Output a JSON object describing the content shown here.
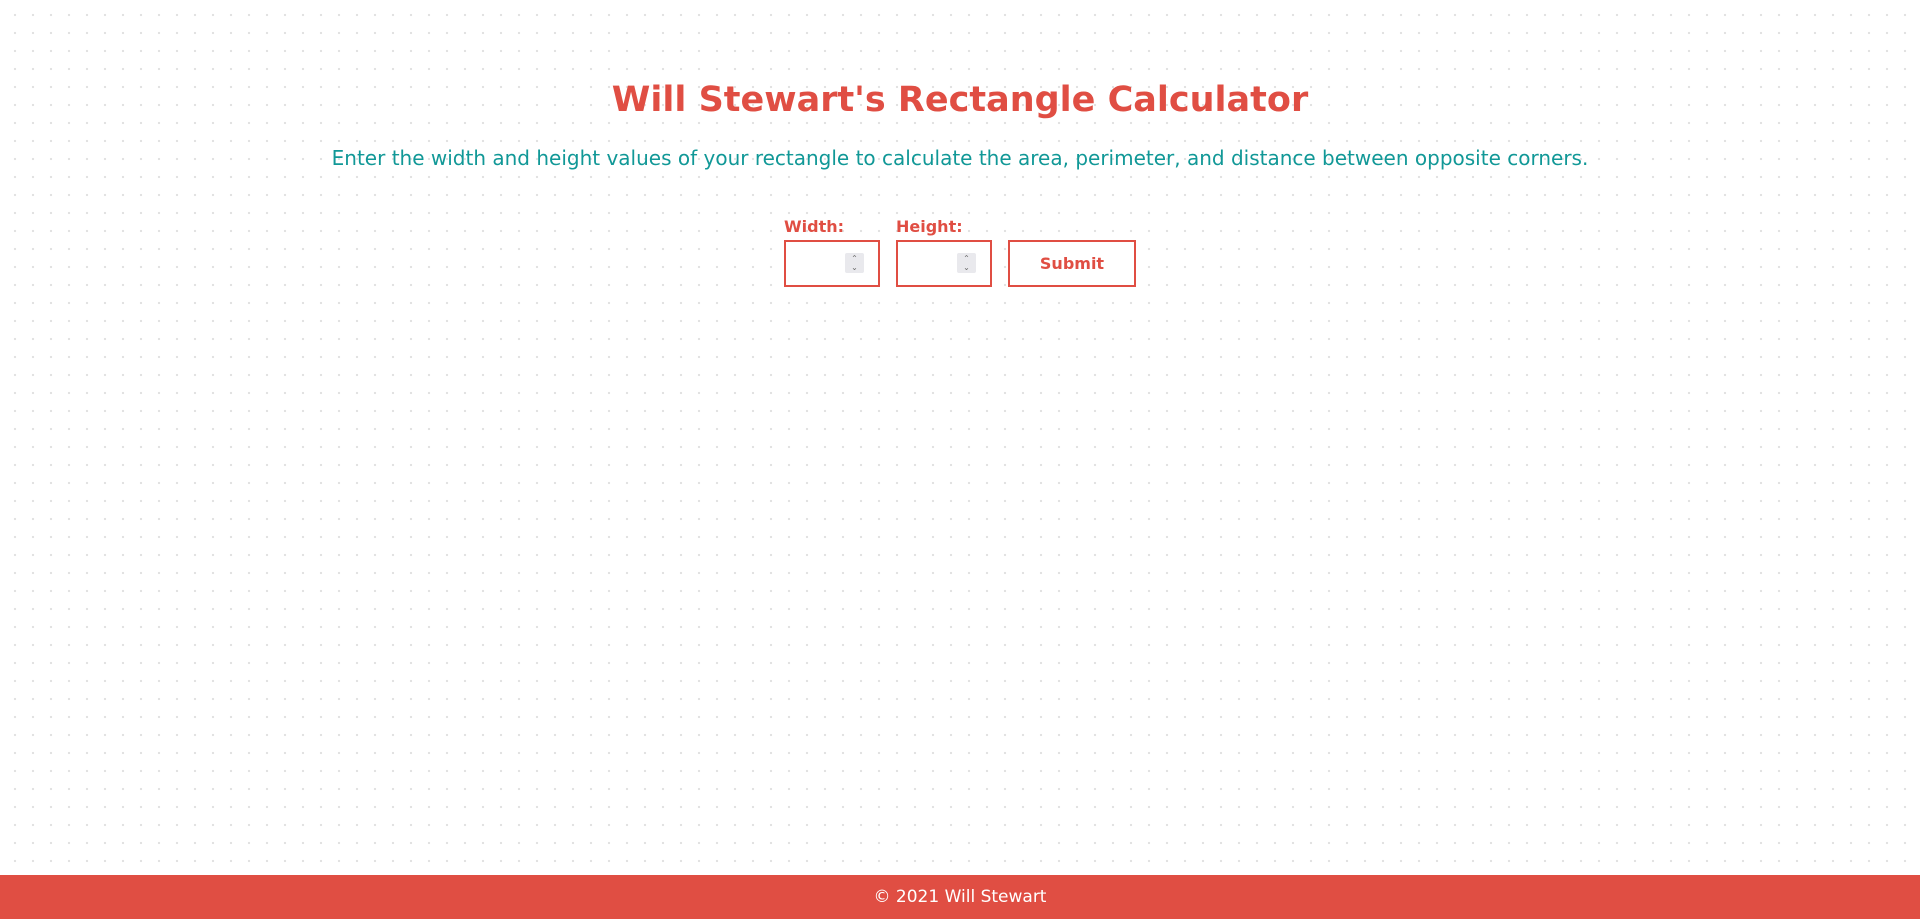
{
  "page": {
    "title": "Will Stewart's Rectangle Calculator",
    "intro": "Enter the width and height values of your rectangle to calculate the area, perimeter, and distance between opposite corners."
  },
  "form": {
    "width_label": "Width:",
    "width_value": "",
    "height_label": "Height:",
    "height_value": "",
    "submit_label": "Submit"
  },
  "footer": {
    "text": "© 2021 Will Stewart"
  },
  "colors": {
    "accent_red": "#e04e43",
    "intro_teal": "#119897",
    "background": "#ffffff"
  },
  "icons": {
    "spinner_up": "chevron-up-icon",
    "spinner_down": "chevron-down-icon"
  }
}
